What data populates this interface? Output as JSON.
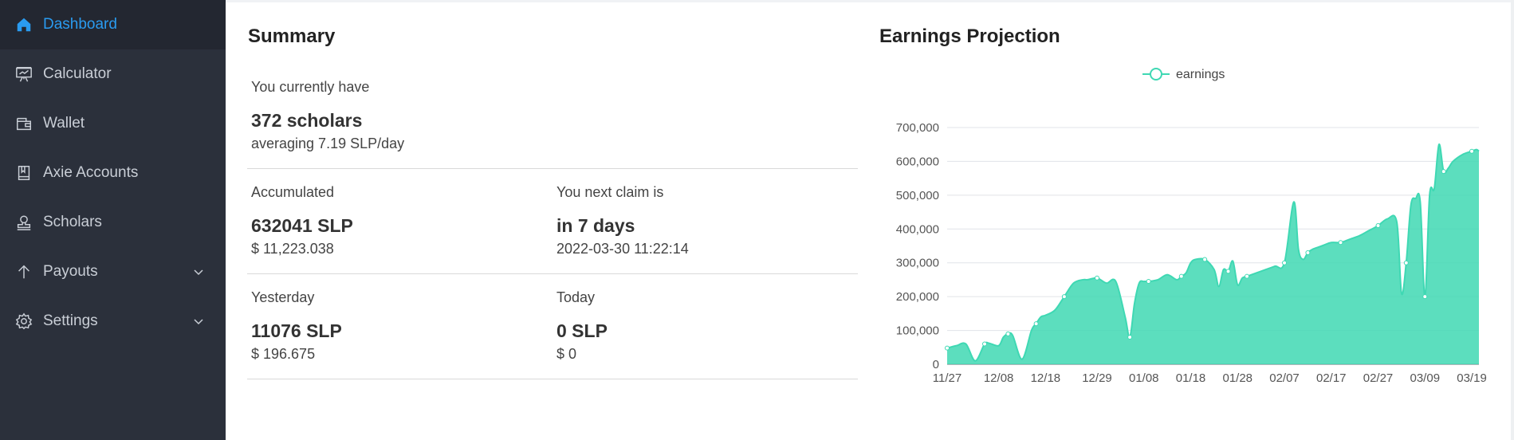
{
  "sidebar": {
    "items": [
      {
        "label": "Dashboard",
        "icon": "home-icon"
      },
      {
        "label": "Calculator",
        "icon": "easel-icon"
      },
      {
        "label": "Wallet",
        "icon": "wallet-icon"
      },
      {
        "label": "Axie Accounts",
        "icon": "book-icon"
      },
      {
        "label": "Scholars",
        "icon": "user-stamp-icon"
      },
      {
        "label": "Payouts",
        "icon": "arrow-up-icon"
      },
      {
        "label": "Settings",
        "icon": "gear-icon"
      }
    ]
  },
  "summary": {
    "title": "Summary",
    "current_label": "You currently have",
    "current_value": "372 scholars",
    "current_sub": "averaging 7.19 SLP/day",
    "accumulated_label": "Accumulated",
    "accumulated_value": "632041 SLP",
    "accumulated_sub": "$ 11,223.038",
    "claim_label": "You next claim is",
    "claim_value": "in 7 days",
    "claim_sub": "2022-03-30 11:22:14",
    "yesterday_label": "Yesterday",
    "yesterday_value": "11076 SLP",
    "yesterday_sub": "$ 196.675",
    "today_label": "Today",
    "today_value": "0 SLP",
    "today_sub": "$ 0"
  },
  "chart_title": "Earnings Projection",
  "colors": {
    "accent": "#2a9bf0",
    "series": "#3fd8b3",
    "sidebar": "#2b303b"
  },
  "chart_data": {
    "type": "area",
    "legend": [
      "earnings"
    ],
    "legend_position": "top-center",
    "x_ticks": [
      "11/27",
      "12/08",
      "12/18",
      "12/29",
      "01/08",
      "01/18",
      "01/28",
      "02/07",
      "02/17",
      "02/27",
      "03/09",
      "03/19"
    ],
    "y_ticks": [
      "0",
      "100,000",
      "200,000",
      "300,000",
      "400,000",
      "500,000",
      "600,000",
      "700,000"
    ],
    "ylim": [
      0,
      700000
    ],
    "grid": true,
    "series": [
      {
        "name": "earnings",
        "x": [
          "11/27",
          "11/29",
          "12/01",
          "12/03",
          "12/05",
          "12/06",
          "12/08",
          "12/09",
          "12/10",
          "12/11",
          "12/13",
          "12/15",
          "12/16",
          "12/17",
          "12/18",
          "12/20",
          "12/22",
          "12/24",
          "12/26",
          "12/27",
          "12/29",
          "12/31",
          "01/02",
          "01/04",
          "01/05",
          "01/06",
          "01/07",
          "01/08",
          "01/09",
          "01/11",
          "01/13",
          "01/15",
          "01/16",
          "01/17",
          "01/18",
          "01/19",
          "01/21",
          "01/23",
          "01/24",
          "01/25",
          "01/26",
          "01/27",
          "01/28",
          "01/29",
          "01/30",
          "02/01",
          "02/03",
          "02/05",
          "02/07",
          "02/09",
          "02/10",
          "02/11",
          "02/12",
          "02/13",
          "02/15",
          "02/17",
          "02/19",
          "02/21",
          "02/23",
          "02/25",
          "02/27",
          "03/01",
          "03/03",
          "03/04",
          "03/05",
          "03/06",
          "03/07",
          "03/08",
          "03/09",
          "03/10",
          "03/11",
          "03/12",
          "03/13",
          "03/14",
          "03/15",
          "03/17",
          "03/19",
          "03/20",
          "03/21"
        ],
        "values": [
          48000,
          55000,
          60000,
          10000,
          60000,
          62000,
          55000,
          80000,
          90000,
          85000,
          15000,
          100000,
          120000,
          140000,
          145000,
          160000,
          200000,
          240000,
          250000,
          250000,
          255000,
          240000,
          245000,
          140000,
          80000,
          180000,
          240000,
          245000,
          245000,
          250000,
          265000,
          250000,
          260000,
          270000,
          300000,
          310000,
          310000,
          280000,
          230000,
          280000,
          275000,
          305000,
          235000,
          255000,
          260000,
          270000,
          280000,
          290000,
          300000,
          480000,
          340000,
          310000,
          330000,
          340000,
          350000,
          360000,
          360000,
          370000,
          380000,
          395000,
          410000,
          430000,
          420000,
          210000,
          300000,
          470000,
          490000,
          480000,
          200000,
          500000,
          520000,
          650000,
          570000,
          580000,
          600000,
          620000,
          630000,
          635000,
          630000
        ]
      }
    ]
  }
}
